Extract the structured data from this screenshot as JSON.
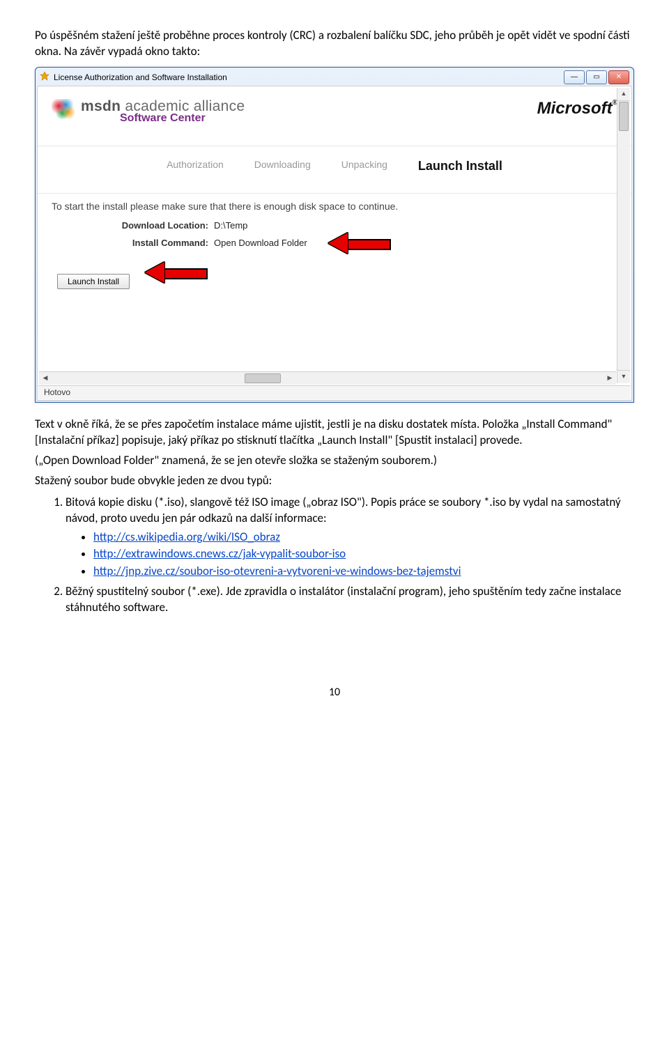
{
  "intro": {
    "para1": "Po úspěšném stažení ještě proběhne proces kontroly (CRC) a rozbalení balíčku SDC, jeho průběh je opět vidět ve spodní části okna. Na závěr vypadá okno takto:"
  },
  "window": {
    "title": "License Authorization and Software Installation",
    "msdn_line1_a": "msdn",
    "msdn_line1_b": " academic alliance",
    "msdn_line2": "Software Center",
    "ms_logo": "Microsoft",
    "steps": {
      "s1": "Authorization",
      "s2": "Downloading",
      "s3": "Unpacking",
      "s4": "Launch Install"
    },
    "instruction": "To start the install please make sure that there is enough disk space to continue.",
    "download_label": "Download Location:",
    "download_value": "D:\\Temp",
    "command_label": "Install Command:",
    "command_value": "Open Download Folder",
    "launch_btn": "Launch Install",
    "status": "Hotovo"
  },
  "after": {
    "para2": "Text v okně říká, že se přes započetím instalace máme ujistit, jestli je na disku dostatek místa. Položka „Install Command\" [Instalační příkaz] popisuje, jaký příkaz po stisknutí tlačítka „Launch Install\" [Spustit instalaci] provede.",
    "para3": "(„Open Download Folder\" znamená, že se jen otevře složka se staženým souborem.)",
    "para4": "Stažený soubor bude obvykle jeden ze dvou typů:",
    "li1": "Bitová kopie disku (*.iso), slangově též ISO image („obraz ISO\"). Popis práce se soubory *.iso by vydal na samostatný návod, proto uvedu jen pár odkazů na další informace:",
    "link1": "http://cs.wikipedia.org/wiki/ISO_obraz",
    "link2": "http://extrawindows.cnews.cz/jak-vypalit-soubor-iso",
    "link3": "http://jnp.zive.cz/soubor-iso-otevreni-a-vytvoreni-ve-windows-bez-tajemstvi",
    "li2": "Běžný spustitelný soubor (*.exe). Jde zpravidla o instalátor (instalační program), jeho spuštěním tedy začne instalace stáhnutého software."
  },
  "page_number": "10"
}
